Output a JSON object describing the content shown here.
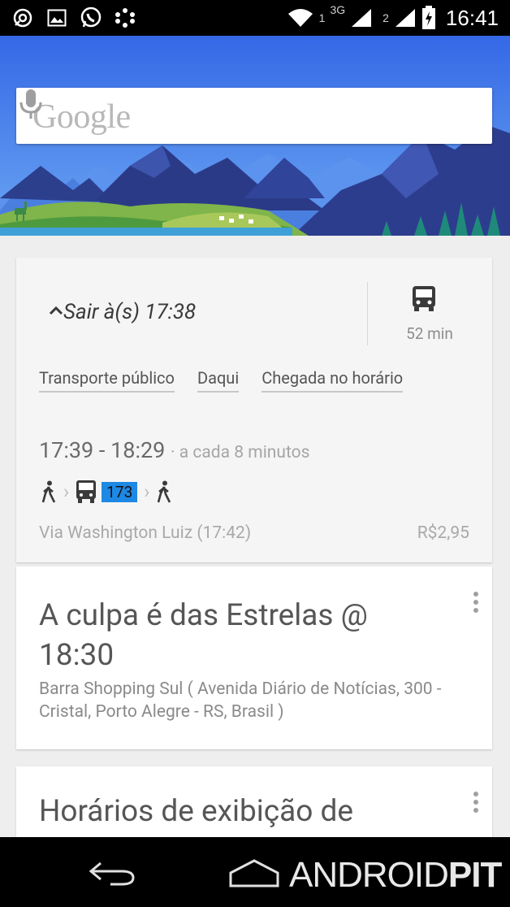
{
  "status_bar": {
    "time": "16:41",
    "sim1_label": "1",
    "network_label": "3G",
    "sim2_label": "2",
    "left_icons": [
      "signal-app-icon",
      "gallery-icon",
      "whatsapp-icon",
      "dots-app-icon"
    ],
    "right_icons": [
      "wifi-icon",
      "signal-icon",
      "signal-icon",
      "battery-charging-icon"
    ]
  },
  "search": {
    "logo_text": "Google",
    "mic_icon": "mic-icon"
  },
  "transit_card": {
    "depart_label": "Sair à(s) 17:38",
    "expand_icon": "chevron-up-icon",
    "mode_icon": "bus-icon",
    "duration": "52 min",
    "options": [
      "Transporte público",
      "Daqui",
      "Chegada no horário"
    ],
    "times": "17:39 - 18:29",
    "frequency": "· a cada 8 minutos",
    "route": {
      "line": "173",
      "steps": [
        "walk-icon",
        "bus-icon",
        "walk-icon"
      ]
    },
    "via": "Via Washington Luiz (17:42)",
    "price": "R$2,95"
  },
  "movie_card": {
    "title": "A culpa é das Estrelas @ 18:30",
    "location": "Barra Shopping Sul ( Avenida Diário de Notícias, 300 - Cristal, Porto Alegre - RS, Brasil )",
    "menu_icon": "more-vert-icon"
  },
  "shows_card": {
    "title": "Horários de exibição de",
    "menu_icon": "more-vert-icon"
  },
  "nav_bar": {
    "back_icon": "back-icon",
    "home_icon": "home-icon",
    "watermark_part1": "ANDROID",
    "watermark_part2": "PIT"
  },
  "colors": {
    "banner_sky": "#3a6ee8",
    "line_badge": "#1e88e5",
    "card_bg": "#f5f5f5"
  }
}
